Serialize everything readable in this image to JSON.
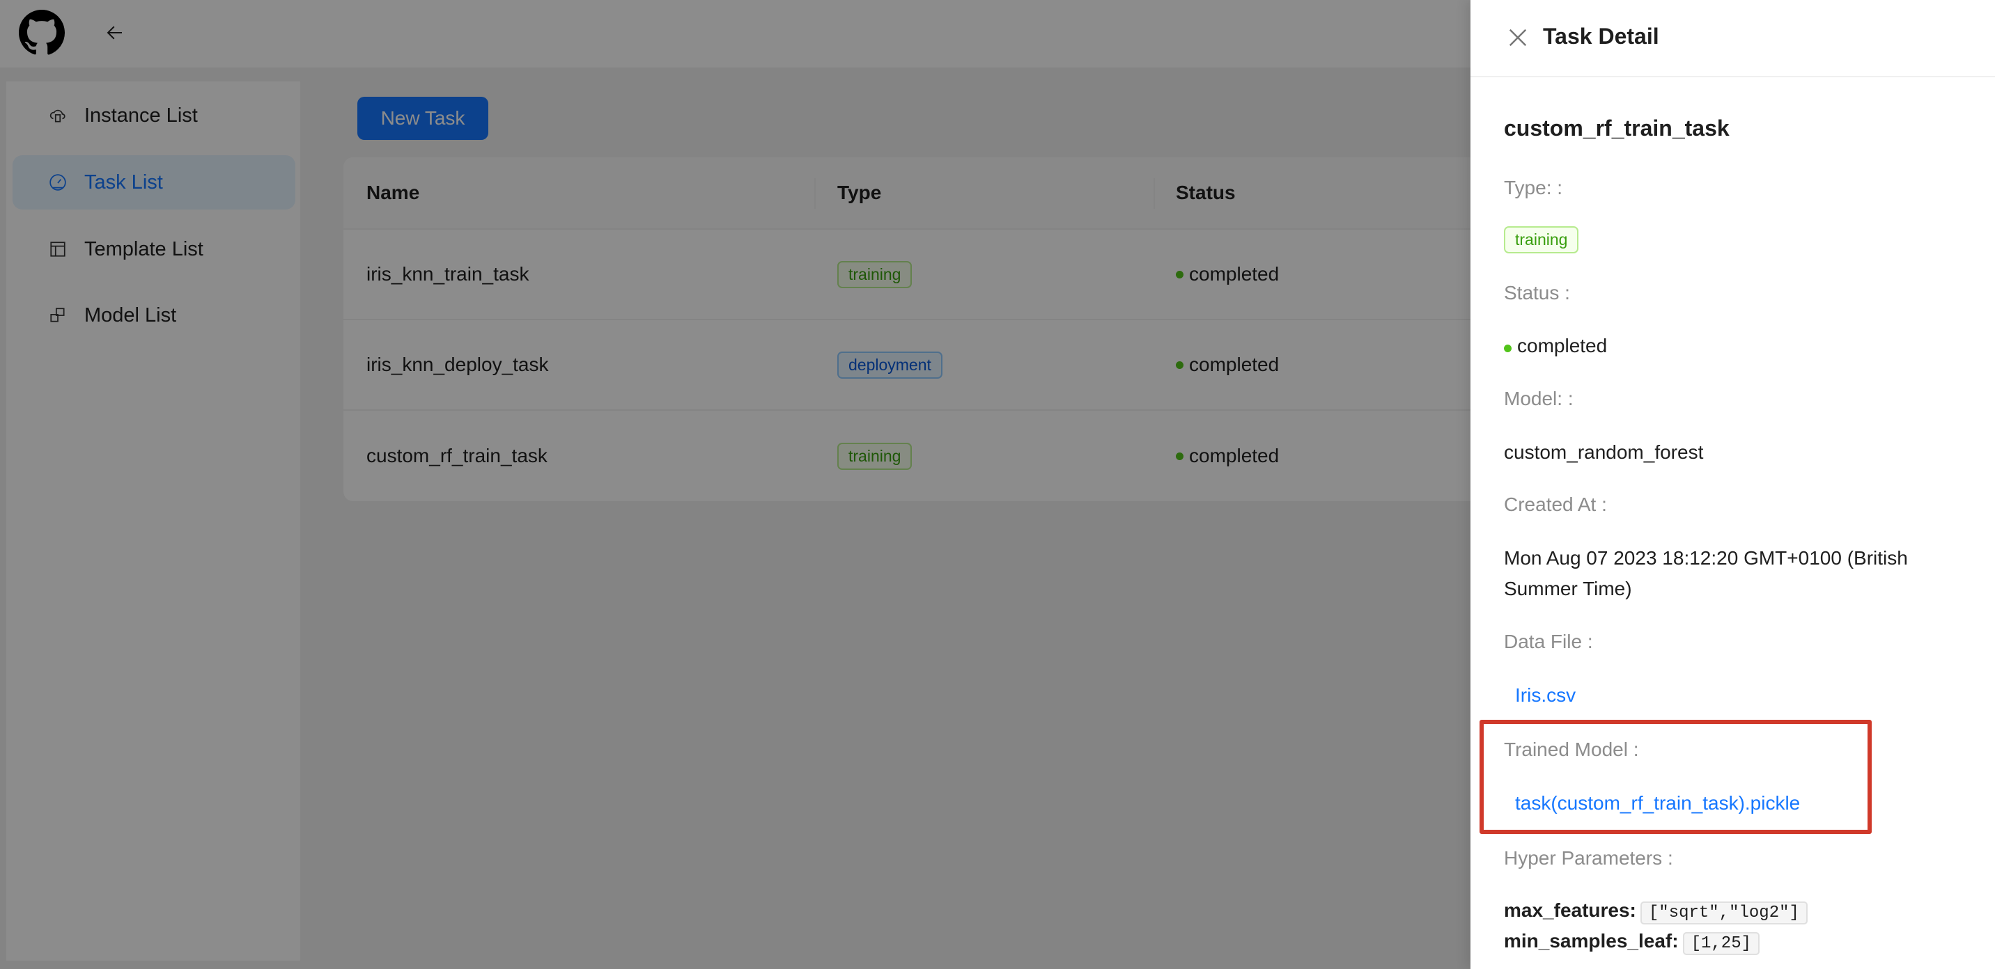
{
  "header": {
    "logo": "github-icon",
    "back": "arrow-left-icon"
  },
  "sidebar": {
    "items": [
      {
        "label": "Instance List",
        "icon": "cloud-server-icon"
      },
      {
        "label": "Task List",
        "icon": "dashboard-icon",
        "active": true
      },
      {
        "label": "Template List",
        "icon": "layout-icon"
      },
      {
        "label": "Model List",
        "icon": "block-icon"
      }
    ]
  },
  "main": {
    "new_task": "New Task",
    "columns": [
      "Name",
      "Type",
      "Status"
    ],
    "rows": [
      {
        "name": "iris_knn_train_task",
        "type": "training",
        "status": "completed"
      },
      {
        "name": "iris_knn_deploy_task",
        "type": "deployment",
        "status": "completed"
      },
      {
        "name": "custom_rf_train_task",
        "type": "training",
        "status": "completed"
      }
    ]
  },
  "drawer": {
    "title": "Task Detail",
    "task_name": "custom_rf_train_task",
    "type_label": "Type: :",
    "type": "training",
    "status_label": "Status :",
    "status": "completed",
    "model_label": "Model: :",
    "model": "custom_random_forest",
    "created_label": "Created At :",
    "created_line1": "Mon Aug 07 2023 18:12:20 GMT+0100 (British",
    "created_line2": "Summer Time)",
    "data_file_label": "Data File :",
    "data_file": "Iris.csv",
    "trained_model_label": "Trained Model :",
    "trained_model": "task(custom_rf_train_task).pickle",
    "hyper_label": "Hyper Parameters :",
    "params": [
      {
        "key": "max_features:",
        "value": "[\"sqrt\",\"log2\"]"
      },
      {
        "key": "min_samples_leaf:",
        "value": "[1,25]"
      }
    ]
  },
  "colors": {
    "primary": "#1677ff",
    "success": "#52c41a",
    "highlight": "#d0392a"
  }
}
